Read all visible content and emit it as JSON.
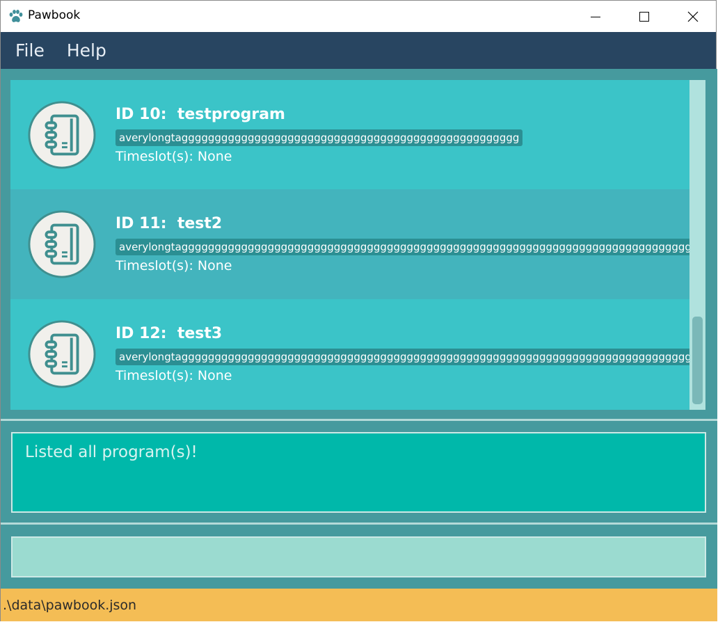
{
  "window": {
    "title": "Pawbook",
    "icon": "paw-icon",
    "controls": [
      "minimize-icon",
      "maximize-icon",
      "close-icon"
    ]
  },
  "menu": {
    "items": [
      {
        "label": "File"
      },
      {
        "label": "Help"
      }
    ]
  },
  "programs": [
    {
      "title": "ID 10:  testprogram",
      "tag": "averylongtaggggggggggggggggggggggggggggggggggggggggggggggggggg",
      "timeslot": "Timeslot(s): None",
      "icon": "notebook-icon"
    },
    {
      "title": "ID 11:  test2",
      "tag": "averylongtaggggggggggggggggggggggggggggggggggggggggggggggggggggggggggggggggggggggggggggggggggggggg",
      "timeslot": "Timeslot(s): None",
      "icon": "notebook-icon"
    },
    {
      "title": "ID 12:  test3",
      "tag": "averylongtaggggggggggggggggggggggggggggggggggggggggggggggggggggggggggggggggggggggggggggggggggggggg",
      "timeslot": "Timeslot(s): None",
      "icon": "notebook-icon"
    }
  ],
  "result": {
    "text": "Listed all program(s)!"
  },
  "command": {
    "value": "",
    "placeholder": ""
  },
  "status": {
    "path": ".\\data\\pawbook.json"
  },
  "colors": {
    "menubar": "#284561",
    "card_light": "#3bc4c8",
    "card_dark": "#43b4bd",
    "result_bg": "#00b8aa",
    "command_bg": "#9bdbd0",
    "statusbar": "#f4bd55"
  }
}
